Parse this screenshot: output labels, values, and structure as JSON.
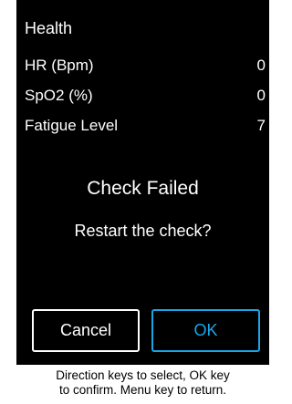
{
  "header": {
    "title": "Health"
  },
  "metrics": [
    {
      "label": "HR (Bpm)",
      "value": "0"
    },
    {
      "label": "SpO2 (%)",
      "value": "0"
    },
    {
      "label": "Fatigue Level",
      "value": "7"
    }
  ],
  "dialog": {
    "title": "Check Failed",
    "message": "Restart the check?",
    "cancel_label": "Cancel",
    "ok_label": "OK"
  },
  "footer": {
    "help_line1": "Direction keys to select, OK key",
    "help_line2": "to confirm. Menu key to return."
  },
  "colors": {
    "background": "#000000",
    "text": "#ffffff",
    "accent": "#1aa6e6",
    "help_background": "#ffffff"
  }
}
